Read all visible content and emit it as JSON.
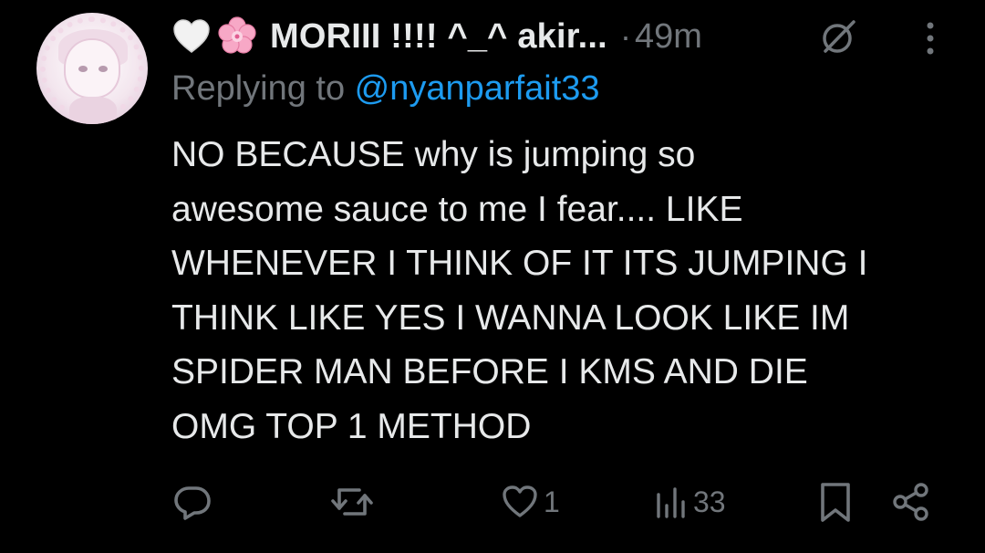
{
  "post": {
    "author": {
      "emoji_1": "white-heart",
      "emoji_2": "cherry-blossom",
      "display_name": "MORIII !!!! ^_^ akir...",
      "avatar": "anime-girl-avatar"
    },
    "separator": "·",
    "time": "49m",
    "replying_label": "Replying to ",
    "replying_handle": "@nyanparfait33",
    "body_lines": [
      "NO BECAUSE why is jumping so",
      "awesome sauce to me I fear.... LIKE",
      "WHENEVER I THINK OF IT ITS JUMPING I",
      "THINK LIKE YES I WANNA LOOK LIKE IM",
      "SPIDER MAN BEFORE I KMS AND DIE",
      "OMG TOP 1 METHOD"
    ],
    "actions": {
      "reply": {
        "icon": "reply-icon",
        "count": ""
      },
      "repost": {
        "icon": "repost-icon",
        "count": ""
      },
      "like": {
        "icon": "heart-icon",
        "count": "1"
      },
      "views": {
        "icon": "views-icon",
        "count": "33"
      },
      "bookmark": {
        "icon": "bookmark-icon"
      },
      "share": {
        "icon": "share-icon"
      }
    }
  },
  "colors": {
    "background": "#000000",
    "text_primary": "#e7e9ea",
    "text_secondary": "#71767b",
    "link": "#1d9bf0"
  }
}
